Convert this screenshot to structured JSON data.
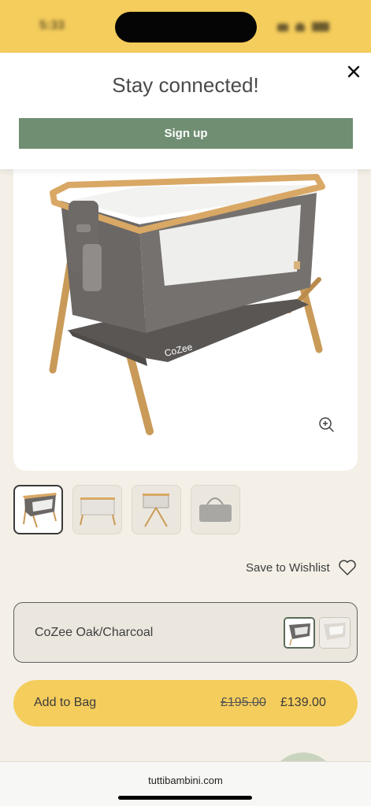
{
  "status": {
    "time": "5:33"
  },
  "popup": {
    "title": "Stay connected!",
    "signup_label": "Sign up",
    "close_icon": "close-icon"
  },
  "product": {
    "image_icon": "bedside-crib",
    "zoom_icon": "zoom-in-icon",
    "thumbnails": [
      "crib-side-view",
      "crib-front-view",
      "crib-end-view",
      "travel-bag"
    ],
    "wishlist_label": "Save to Wishlist",
    "variant_label": "CoZee Oak/Charcoal",
    "add_to_bag_label": "Add to Bag",
    "price_old": "£195.00",
    "price_new": "£139.00",
    "brand_mark": "CoZee"
  },
  "browser": {
    "url": "tuttibambini.com"
  },
  "colors": {
    "accent_yellow": "#f5cd5c",
    "signup_green": "#6f8e72",
    "page_bg": "#f4f0e8"
  }
}
